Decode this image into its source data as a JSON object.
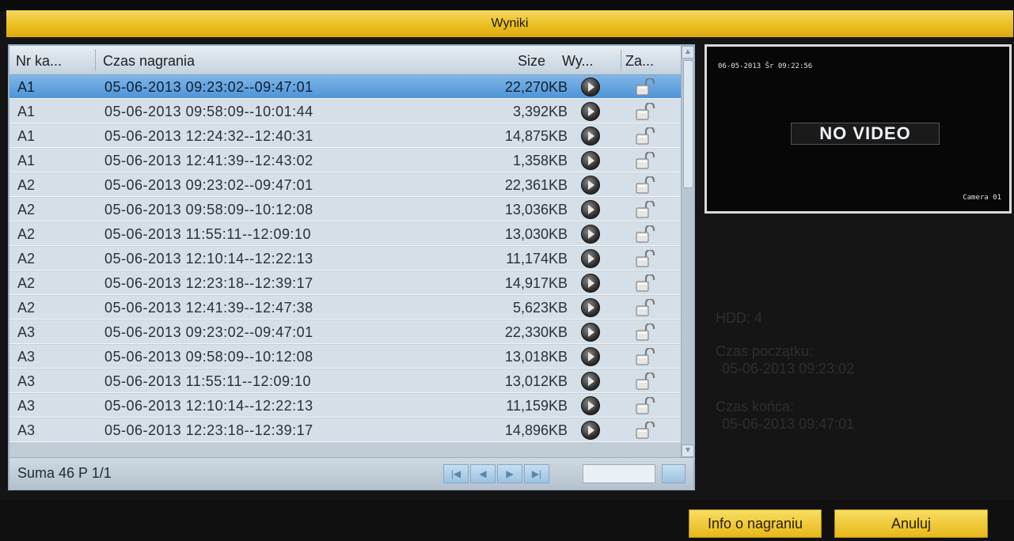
{
  "window": {
    "title": "Wyniki"
  },
  "table": {
    "headers": {
      "channel": "Nr ka...",
      "time": "Czas nagrania",
      "size": "Size",
      "play": "Wy...",
      "lock": "Za..."
    },
    "rows": [
      {
        "channel": "A1",
        "time": "05-06-2013 09:23:02--09:47:01",
        "size": "22,270KB",
        "selected": true
      },
      {
        "channel": "A1",
        "time": "05-06-2013 09:58:09--10:01:44",
        "size": "3,392KB"
      },
      {
        "channel": "A1",
        "time": "05-06-2013 12:24:32--12:40:31",
        "size": "14,875KB"
      },
      {
        "channel": "A1",
        "time": "05-06-2013 12:41:39--12:43:02",
        "size": "1,358KB"
      },
      {
        "channel": "A2",
        "time": "05-06-2013 09:23:02--09:47:01",
        "size": "22,361KB"
      },
      {
        "channel": "A2",
        "time": "05-06-2013 09:58:09--10:12:08",
        "size": "13,036KB"
      },
      {
        "channel": "A2",
        "time": "05-06-2013 11:55:11--12:09:10",
        "size": "13,030KB"
      },
      {
        "channel": "A2",
        "time": "05-06-2013 12:10:14--12:22:13",
        "size": "11,174KB"
      },
      {
        "channel": "A2",
        "time": "05-06-2013 12:23:18--12:39:17",
        "size": "14,917KB"
      },
      {
        "channel": "A2",
        "time": "05-06-2013 12:41:39--12:47:38",
        "size": "5,623KB"
      },
      {
        "channel": "A3",
        "time": "05-06-2013 09:23:02--09:47:01",
        "size": "22,330KB"
      },
      {
        "channel": "A3",
        "time": "05-06-2013 09:58:09--10:12:08",
        "size": "13,018KB"
      },
      {
        "channel": "A3",
        "time": "05-06-2013 11:55:11--12:09:10",
        "size": "13,012KB"
      },
      {
        "channel": "A3",
        "time": "05-06-2013 12:10:14--12:22:13",
        "size": "11,159KB"
      },
      {
        "channel": "A3",
        "time": "05-06-2013 12:23:18--12:39:17",
        "size": "14,896KB"
      }
    ],
    "row_icons": {
      "play": "play-icon",
      "lock": "unlock-icon"
    }
  },
  "footer": {
    "summary": "Suma 46 P 1/1",
    "pager_icons": [
      "first-page-icon",
      "prev-page-icon",
      "next-page-icon",
      "last-page-icon"
    ],
    "go_icon": "go-arrow-icon"
  },
  "preview": {
    "osd_timestamp": "06-05-2013 Šr 09:22:56",
    "status": "NO VIDEO",
    "camera": "Camera 01"
  },
  "details": {
    "hdd": "HDD: 4",
    "start_label": "Czas początku:",
    "start_value": "05-06-2013 09:23:02",
    "end_label": "Czas końca:",
    "end_value": "05-06-2013 09:47:01"
  },
  "buttons": {
    "info": "Info o nagraniu",
    "cancel": "Anuluj"
  },
  "colors": {
    "title_bar": "#e9bd1c",
    "selected_row": "#4e94d6",
    "list_bg": "#d5dfe8",
    "button": "#f0c832"
  }
}
